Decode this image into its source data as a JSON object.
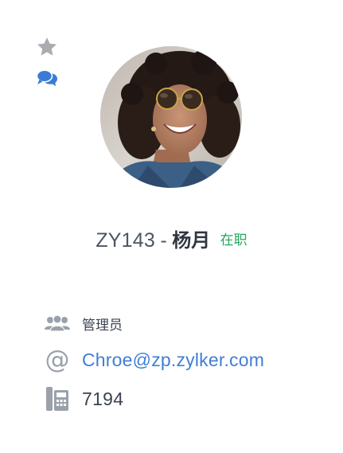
{
  "profile": {
    "employee_id": "ZY143",
    "separator": "-",
    "name": "杨月",
    "status": "在职",
    "role": "管理员",
    "email": "Chroe@zp.zylker.com",
    "extension": "7194"
  },
  "icons": {
    "favorite": "star-icon",
    "chat": "chat-bubbles-icon",
    "role": "people-group-icon",
    "email": "at-sign-icon",
    "phone": "desk-phone-icon"
  },
  "colors": {
    "status_active": "#22a85b",
    "link": "#3f7fd4",
    "chat_icon": "#3a7bd5",
    "star_icon": "#a9acb1",
    "muted_icon": "#9aa1aa"
  }
}
